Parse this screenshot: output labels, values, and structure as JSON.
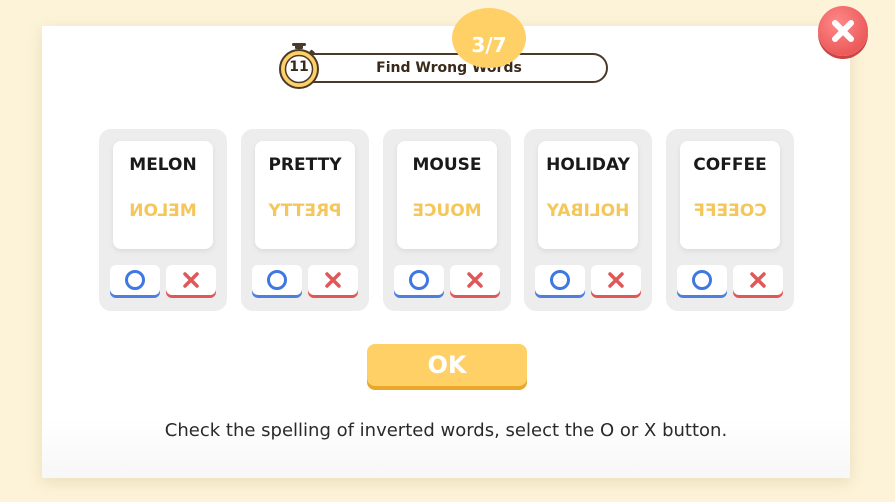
{
  "progress": "3/7",
  "timer": {
    "value": "11"
  },
  "title": "Find Wrong Words",
  "cards": [
    {
      "word": "MELON",
      "inverted": "MELON"
    },
    {
      "word": "PRETTY",
      "inverted": "PRETTY"
    },
    {
      "word": "MOUSE",
      "inverted": "MOUCE"
    },
    {
      "word": "HOLIDAY",
      "inverted": "HOLIBAY"
    },
    {
      "word": "COFFEE",
      "inverted": "COEEFF"
    }
  ],
  "ok_label": "OK",
  "instructions": "Check the spelling of inverted words, select the O or X button.",
  "colors": {
    "accent": "#ffd066",
    "o_button": "#3f78e0",
    "x_button": "#e05757",
    "close": "#ec5a5a",
    "background": "#fdf3d8"
  },
  "icons": [
    "close-icon",
    "stopwatch-icon",
    "circle-o-icon",
    "cross-x-icon"
  ]
}
